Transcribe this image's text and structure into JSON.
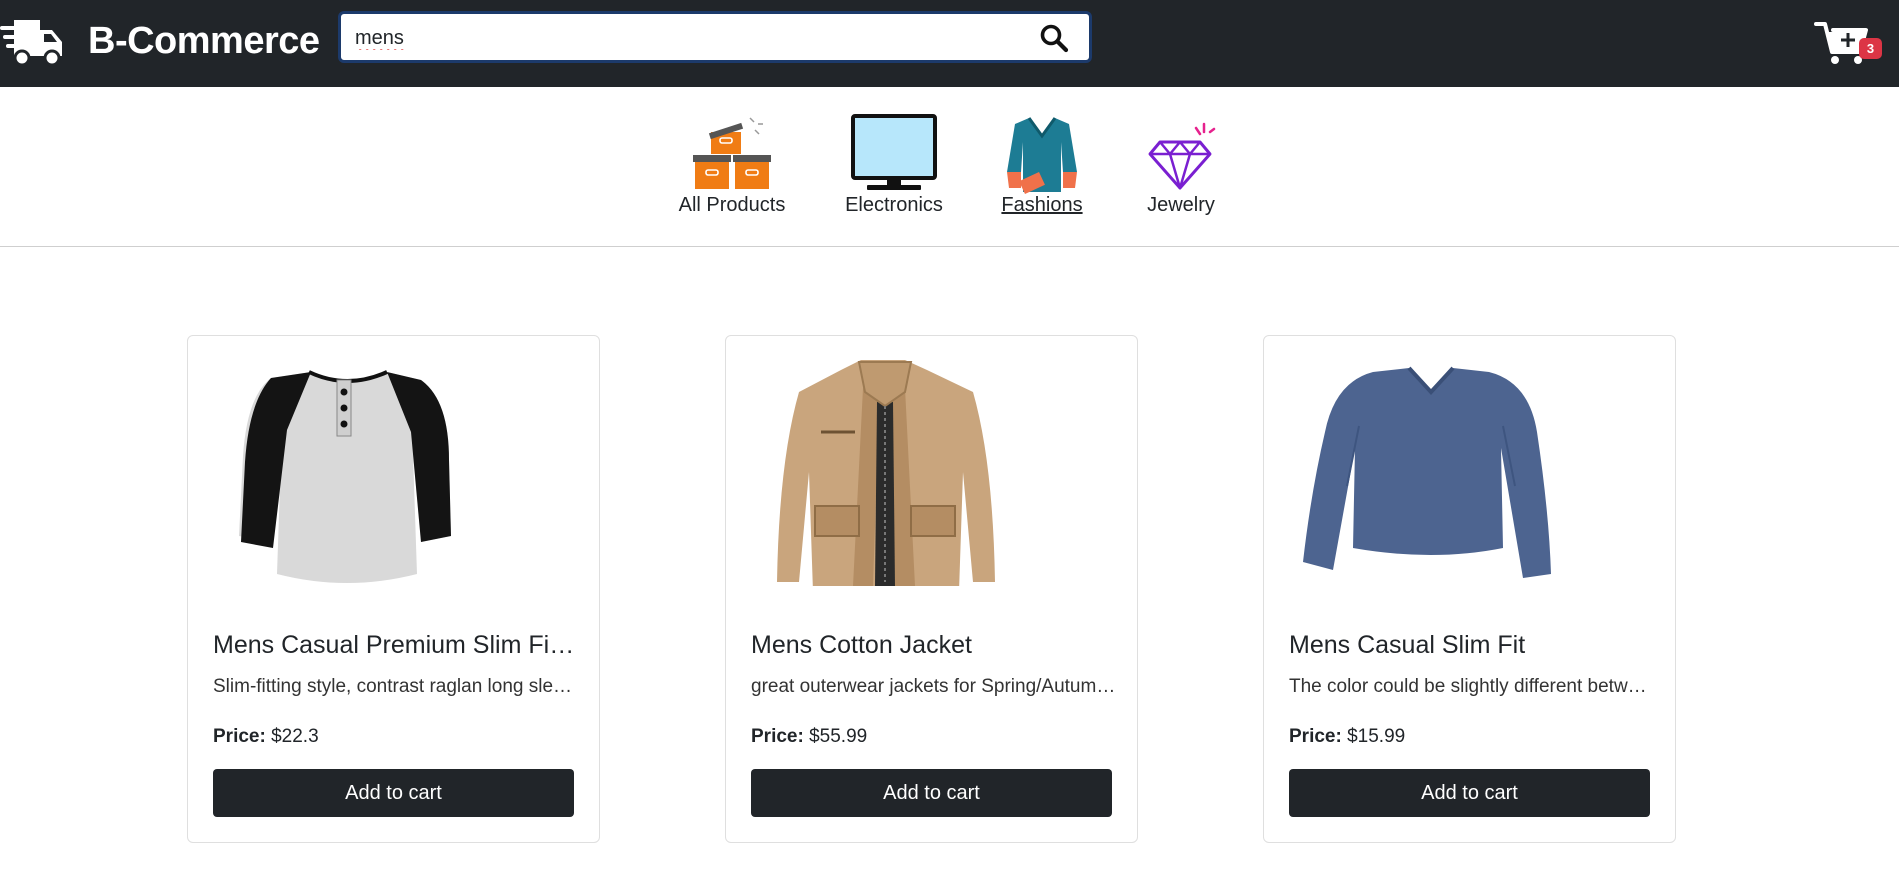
{
  "header": {
    "brand": "B-Commerce",
    "brand_icon": "delivery-truck-icon",
    "search": {
      "value": "mens",
      "icon": "search-icon"
    },
    "cart": {
      "icon": "cart-plus-icon",
      "count": "3"
    }
  },
  "categories": [
    {
      "label": "All Products",
      "icon": "boxes-icon",
      "active": false
    },
    {
      "label": "Electronics",
      "icon": "monitor-icon",
      "active": false
    },
    {
      "label": "Fashions",
      "icon": "jacket-icon",
      "active": true
    },
    {
      "label": "Jewelry",
      "icon": "diamond-icon",
      "active": false
    }
  ],
  "products": [
    {
      "title": "Mens Casual Premium Slim Fit T-Shirts",
      "description": "Slim-fitting style, contrast raglan long sleeve, three-button henley placket",
      "price_label": "Price:",
      "price": "$22.3",
      "button": "Add to cart",
      "image": "raglan-henley-shirt-image"
    },
    {
      "title": "Mens Cotton Jacket",
      "description": "great outerwear jackets for Spring/Autumn/Winter",
      "price_label": "Price:",
      "price": "$55.99",
      "button": "Add to cart",
      "image": "khaki-cotton-jacket-image"
    },
    {
      "title": "Mens Casual Slim Fit",
      "description": "The color could be slightly different between on the screen and in practice",
      "price_label": "Price:",
      "price": "$15.99",
      "button": "Add to cart",
      "image": "blue-vneck-longsleeve-image"
    }
  ],
  "colors": {
    "navbar": "#212529",
    "badge": "#dc3545",
    "button": "#212529",
    "accent_orange": "#f07c14"
  }
}
